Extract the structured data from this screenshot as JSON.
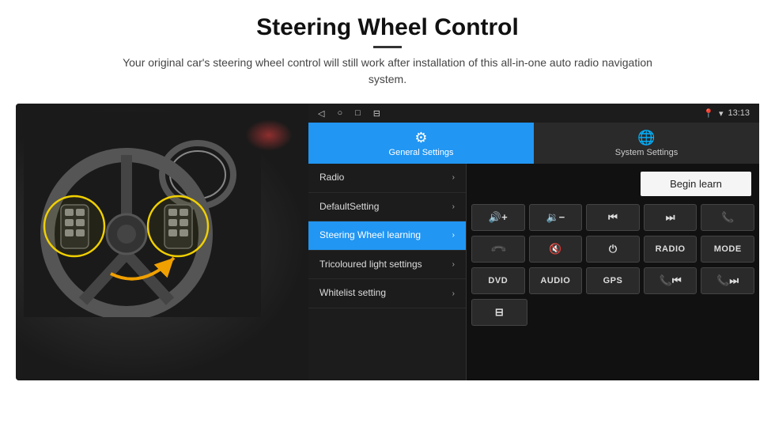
{
  "header": {
    "title": "Steering Wheel Control",
    "subtitle": "Your original car's steering wheel control will still work after installation of this all-in-one auto radio navigation system."
  },
  "status_bar": {
    "time": "13:13",
    "icons": [
      "◁",
      "○",
      "□",
      "⊟"
    ]
  },
  "tabs": [
    {
      "id": "general",
      "label": "General Settings",
      "active": true
    },
    {
      "id": "system",
      "label": "System Settings",
      "active": false
    }
  ],
  "menu_items": [
    {
      "id": "radio",
      "label": "Radio",
      "active": false
    },
    {
      "id": "default",
      "label": "DefaultSetting",
      "active": false
    },
    {
      "id": "steering",
      "label": "Steering Wheel learning",
      "active": true
    },
    {
      "id": "tricoloured",
      "label": "Tricoloured light settings",
      "active": false
    },
    {
      "id": "whitelist",
      "label": "Whitelist setting",
      "active": false
    }
  ],
  "begin_learn_label": "Begin learn",
  "control_buttons": {
    "row1": [
      {
        "id": "vol-up",
        "label": "🔊+",
        "symbol": "🔊+"
      },
      {
        "id": "vol-down",
        "label": "🔉-",
        "symbol": "🔉-"
      },
      {
        "id": "prev",
        "label": "⏮",
        "symbol": "⏮"
      },
      {
        "id": "next",
        "label": "⏭",
        "symbol": "⏭"
      },
      {
        "id": "phone",
        "label": "📞",
        "symbol": "📞"
      }
    ],
    "row2": [
      {
        "id": "hangup",
        "label": "↩",
        "symbol": "↩"
      },
      {
        "id": "mute",
        "label": "🔇x",
        "symbol": "🔇"
      },
      {
        "id": "power",
        "label": "⏻",
        "symbol": "⏻"
      },
      {
        "id": "radio-btn",
        "label": "RADIO",
        "symbol": "RADIO",
        "text": true
      },
      {
        "id": "mode",
        "label": "MODE",
        "symbol": "MODE",
        "text": true
      }
    ],
    "row3": [
      {
        "id": "dvd",
        "label": "DVD",
        "symbol": "DVD",
        "text": true
      },
      {
        "id": "audio",
        "label": "AUDIO",
        "symbol": "AUDIO",
        "text": true
      },
      {
        "id": "gps",
        "label": "GPS",
        "symbol": "GPS",
        "text": true
      },
      {
        "id": "tel-prev",
        "label": "📞⏮",
        "symbol": "📞⏮"
      },
      {
        "id": "tel-next",
        "label": "📞⏭",
        "symbol": "📞⏭"
      }
    ],
    "row4": [
      {
        "id": "extra",
        "label": "⊟",
        "symbol": "⊟"
      }
    ]
  }
}
